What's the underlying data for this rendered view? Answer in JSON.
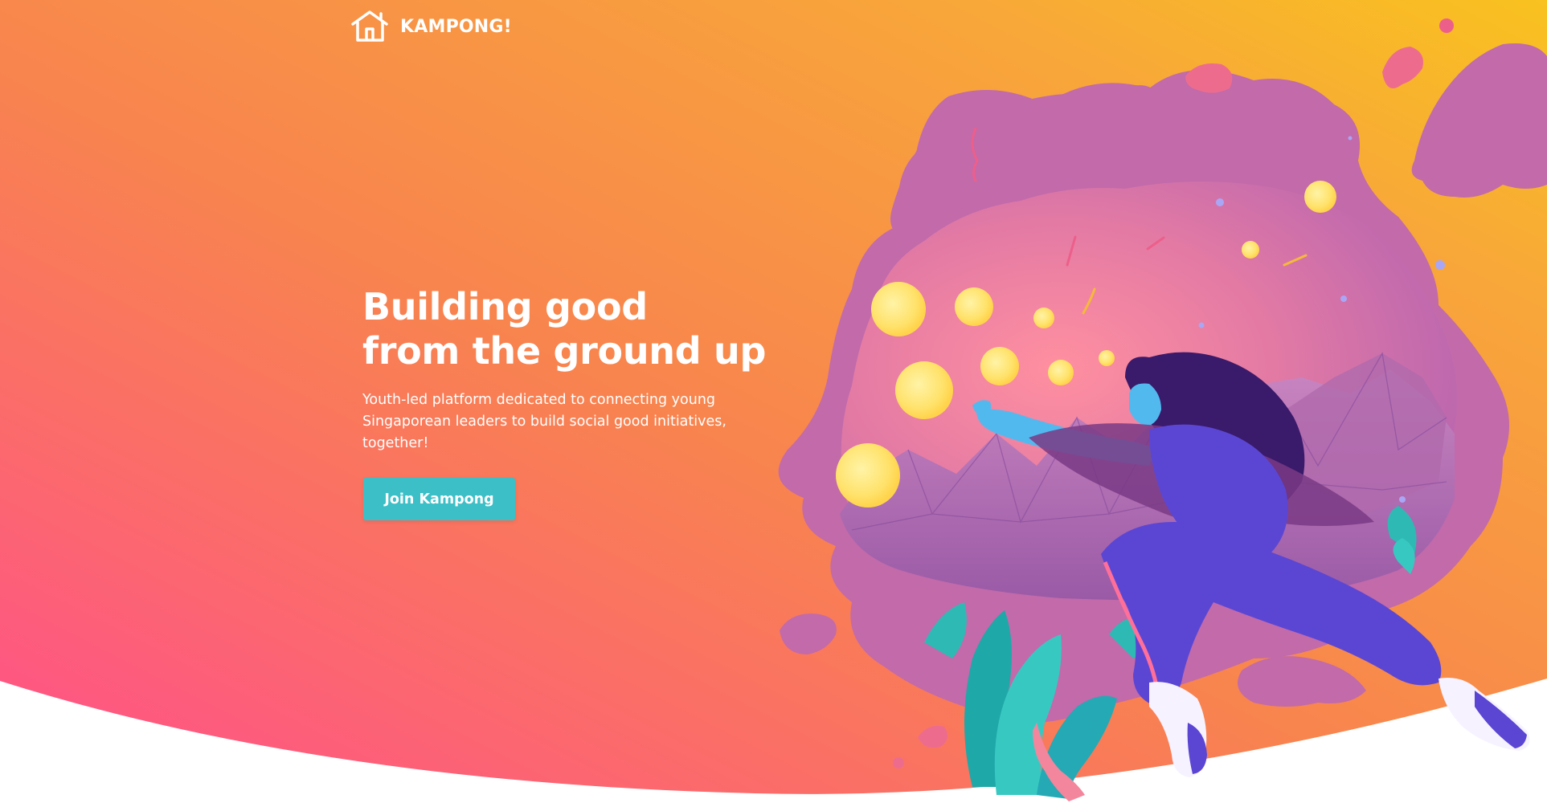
{
  "brand": {
    "name": "KAMPONG!",
    "logo_icon": "house-icon"
  },
  "hero": {
    "headline_line1": "Building good",
    "headline_line2": "from the ground up",
    "subtext": "Youth-led platform dedicated to connecting young Singaporean leaders to build social good initiatives, together!",
    "cta_label": "Join Kampong"
  },
  "colors": {
    "gradient_start": "#ff4f8b",
    "gradient_mid": "#f8834f",
    "gradient_end": "#f9c21f",
    "cta": "#3cbfc6",
    "blob_purple": "#c26aaa",
    "figure_purple": "#5b46d4",
    "orb_yellow": "#ffe26b",
    "plant_teal": "#2fb9b4"
  },
  "illustration": {
    "subject": "girl-leaping-toward-glowing-orbs-illustration"
  }
}
